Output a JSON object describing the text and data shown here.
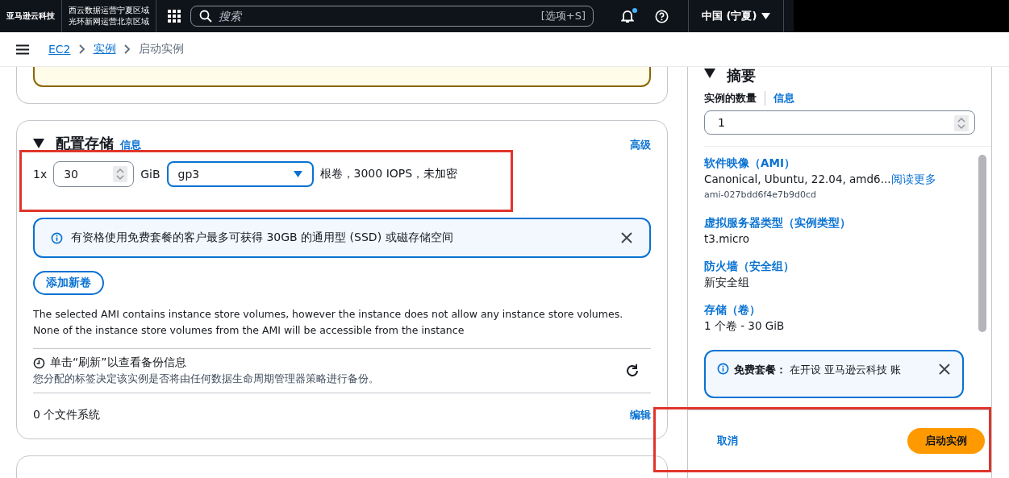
{
  "top_nav": {
    "logo": "亚马逊云科技",
    "region_note": [
      "西云数据运营宁夏区域",
      "光环新网运营北京区域"
    ],
    "search": {
      "placeholder": "搜索",
      "shortcut": "[选项+S]"
    },
    "notification_dot": true,
    "region": "中国 (宁夏)"
  },
  "breadcrumb": [
    {
      "label": "EC2",
      "kind": "link"
    },
    {
      "label": "实例",
      "kind": "link"
    },
    {
      "label": "启动实例",
      "kind": "current"
    }
  ],
  "storage": {
    "title": "配置存储",
    "info": "信息",
    "advanced": "高级",
    "volume": {
      "count": "1x",
      "size": "30",
      "unit": "GiB",
      "type": "gp3",
      "details": "根卷，3000 IOPS，未加密"
    },
    "alert": {
      "text": "有资格使用免费套餐的客户最多可获得 30GB 的通用型 (SSD) 或磁存储空间"
    },
    "add_button": "添加新卷",
    "note": [
      "The selected AMI contains instance store volumes, however the instance does not allow any instance store volumes.",
      "None of the instance store volumes from the AMI will be accessible from the instance"
    ],
    "backup": {
      "title": "单击“刷新”以查看备份信息",
      "description": "您分配的标签决定该实例是否将由任何数据生命周期管理器策略进行备份。"
    },
    "file_systems": {
      "label": "0 个文件系统",
      "edit": "编辑"
    }
  },
  "summary": {
    "title": "摘要",
    "count_label": "实例的数量",
    "count_info": "信息",
    "count_value": "1",
    "items": [
      {
        "label": "软件映像（AMI）",
        "value": "Canonical, Ubuntu, 22.04, amd6...",
        "link": "阅读更多",
        "sub": "ami-027bdd6f4e7b9d0cd"
      },
      {
        "label": "虚拟服务器类型（实例类型）",
        "value": "t3.micro"
      },
      {
        "label": "防火墙（安全组）",
        "value": "新安全组"
      },
      {
        "label": "存储（卷）",
        "value": "1 个卷 - 30 GiB"
      }
    ],
    "free_tier": "**免费套餐：** 在开设 亚马逊云科技 账",
    "cancel": "取消",
    "launch": "启动实例"
  }
}
